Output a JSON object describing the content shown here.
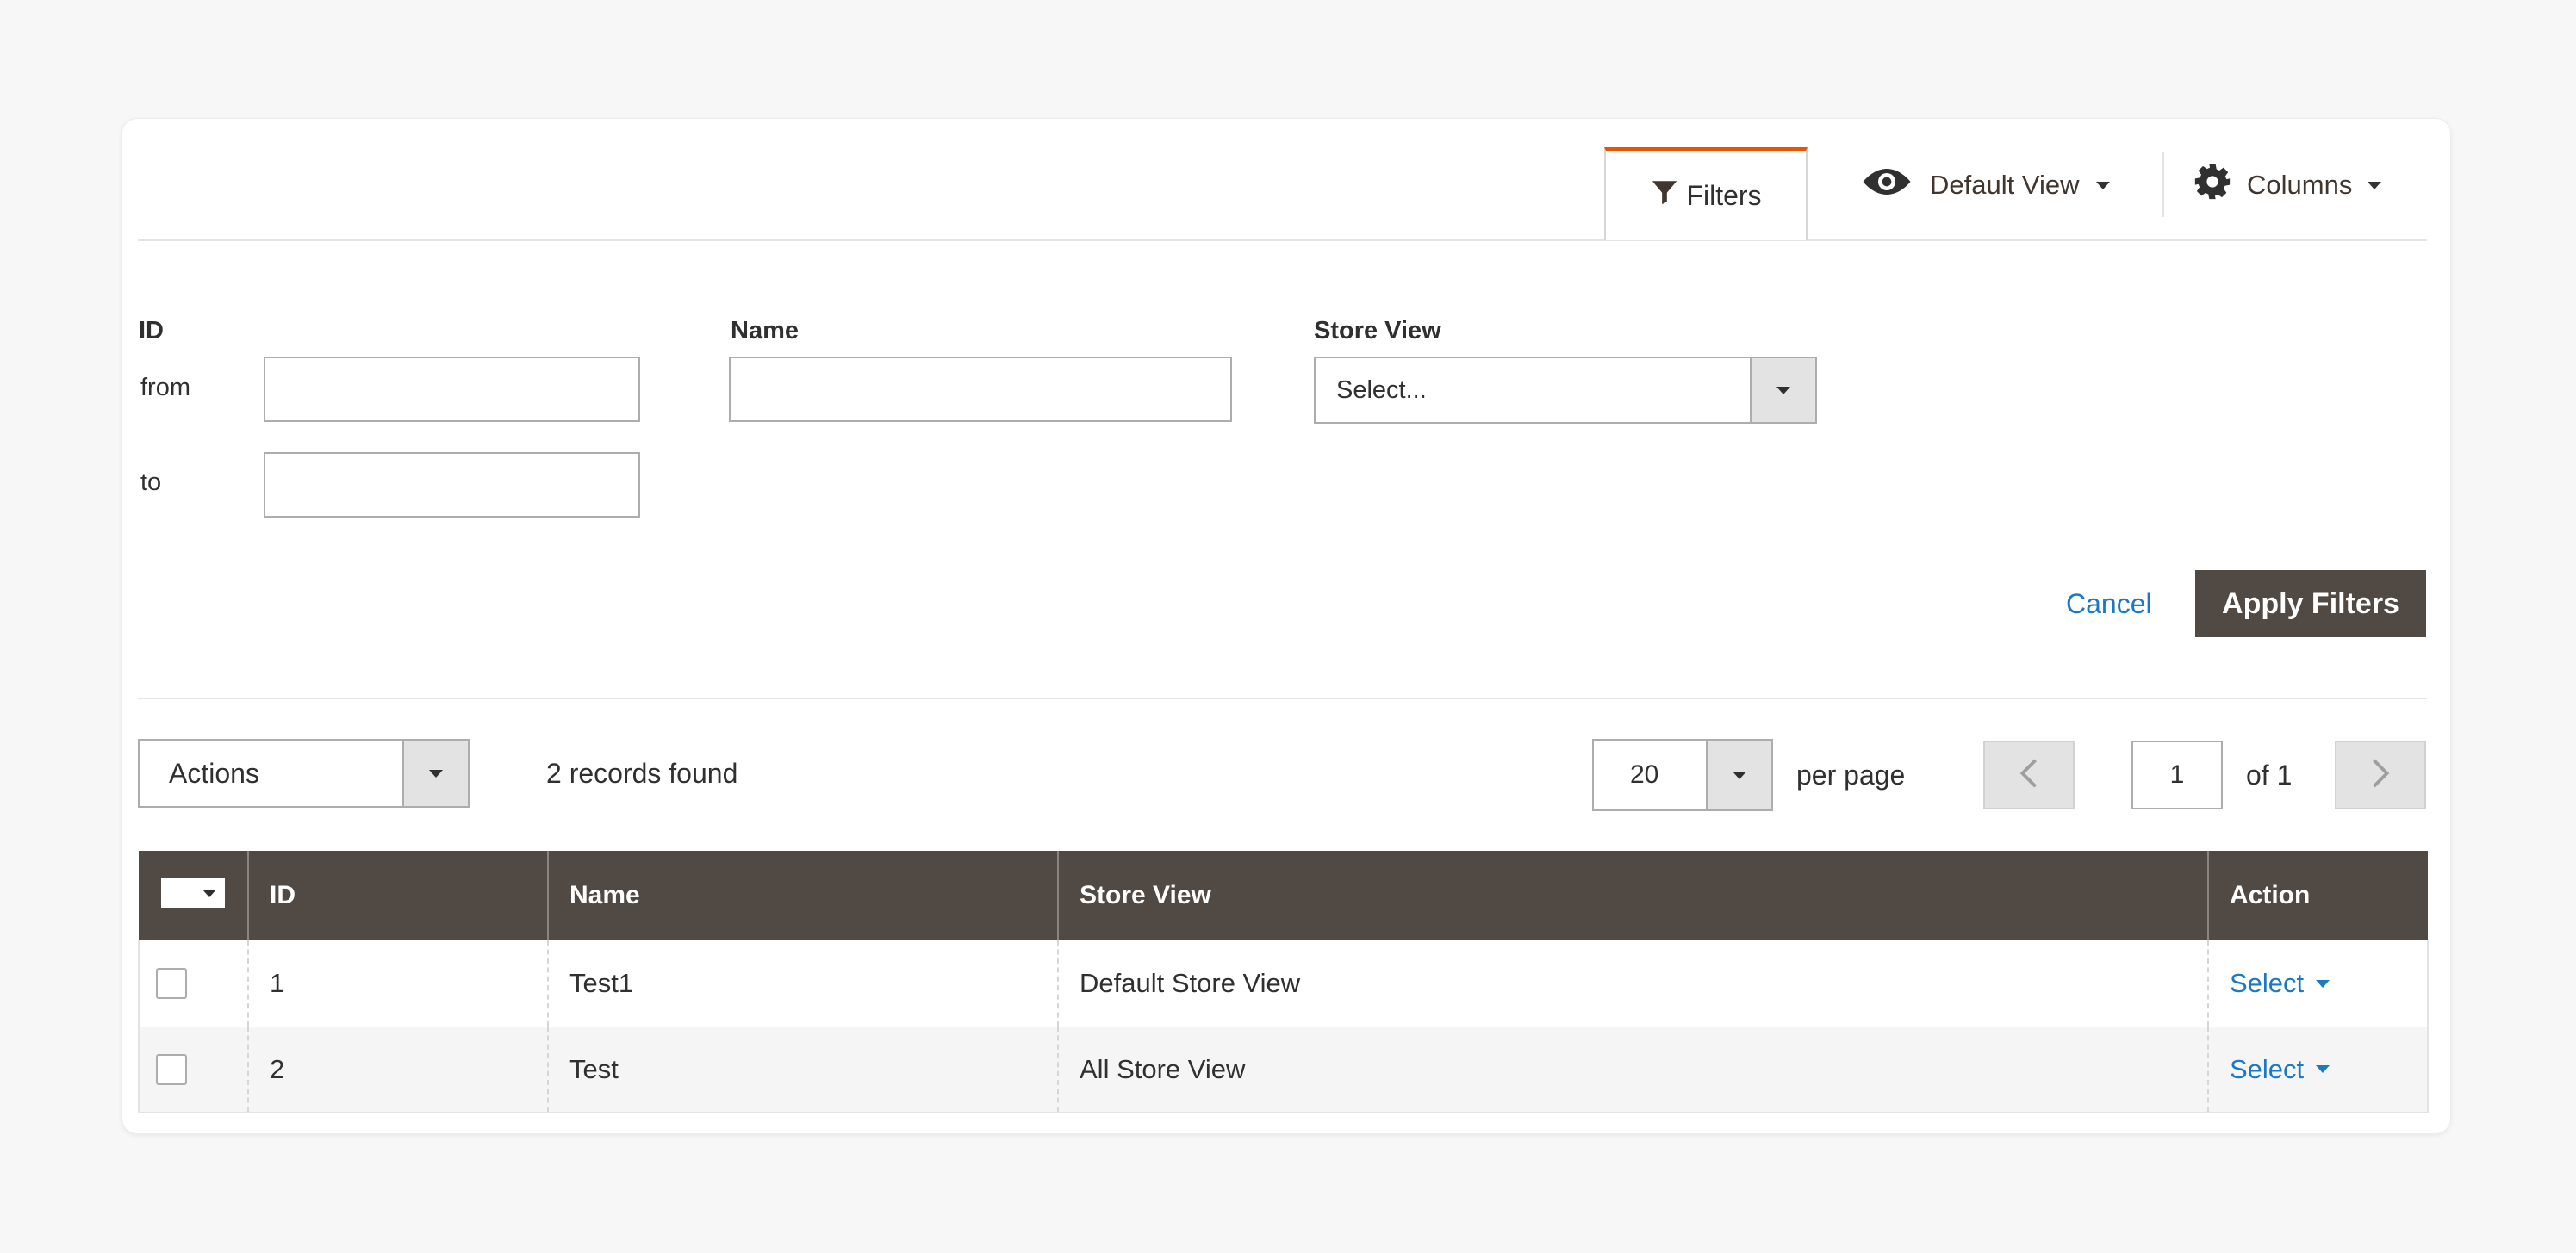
{
  "toolbar": {
    "filters_label": "Filters",
    "view_label": "Default View",
    "columns_label": "Columns"
  },
  "filters": {
    "id_label": "ID",
    "from_label": "from",
    "to_label": "to",
    "id_from_value": "",
    "id_to_value": "",
    "name_label": "Name",
    "name_value": "",
    "store_view_label": "Store View",
    "store_view_placeholder": "Select...",
    "cancel_label": "Cancel",
    "apply_label": "Apply Filters"
  },
  "actions": {
    "label": "Actions",
    "records_found": "2 records found"
  },
  "pagination": {
    "per_page_value": "20",
    "per_page_label": "per page",
    "current_page": "1",
    "of_label": "of 1"
  },
  "grid": {
    "columns": [
      "ID",
      "Name",
      "Store View",
      "Action"
    ],
    "rows": [
      {
        "id": "1",
        "name": "Test1",
        "store_view": "Default Store View",
        "action": "Select"
      },
      {
        "id": "2",
        "name": "Test",
        "store_view": "All Store View",
        "action": "Select"
      }
    ]
  },
  "colors": {
    "accent": "#eb5202",
    "header_bg": "#514943",
    "link": "#1979c3",
    "background": "#f7f7f7"
  },
  "icons": {
    "filters": "funnel-icon",
    "view": "eye-icon",
    "columns": "gear-icon",
    "prev": "chevron-left-icon",
    "next": "chevron-right-icon"
  }
}
